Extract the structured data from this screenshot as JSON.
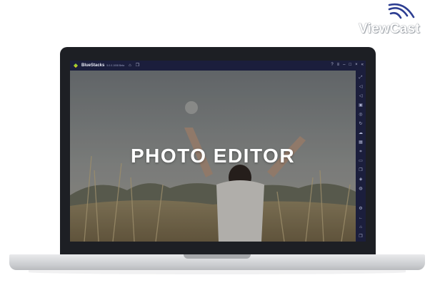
{
  "watermark": {
    "text": "ViewCast",
    "icon": "signal-waves-icon"
  },
  "app": {
    "name": "BlueStacks",
    "version": "5.0.0.1008 Beta",
    "titlebar_icons_left": [
      "home-icon",
      "multi-instance-icon"
    ],
    "titlebar_icons_right": [
      "help-icon",
      "menu-icon",
      "minimize-icon",
      "maximize-icon",
      "close-icon"
    ],
    "colors": {
      "titlebar": "#1b1e3c",
      "sidebar": "#1b1e3c"
    }
  },
  "content": {
    "title": "PHOTO EDITOR"
  },
  "sidebar": {
    "icons_top": [
      "expand-icon",
      "volume-up-icon",
      "volume-down-icon",
      "media-icon",
      "camera-icon",
      "rotate-icon",
      "cloud-icon",
      "apk-icon",
      "screenshot-icon",
      "folder-icon",
      "multi-instance-icon",
      "layers-icon",
      "eco-icon"
    ],
    "icons_bottom": [
      "settings-icon",
      "back-icon",
      "home-icon",
      "recent-apps-icon"
    ]
  }
}
